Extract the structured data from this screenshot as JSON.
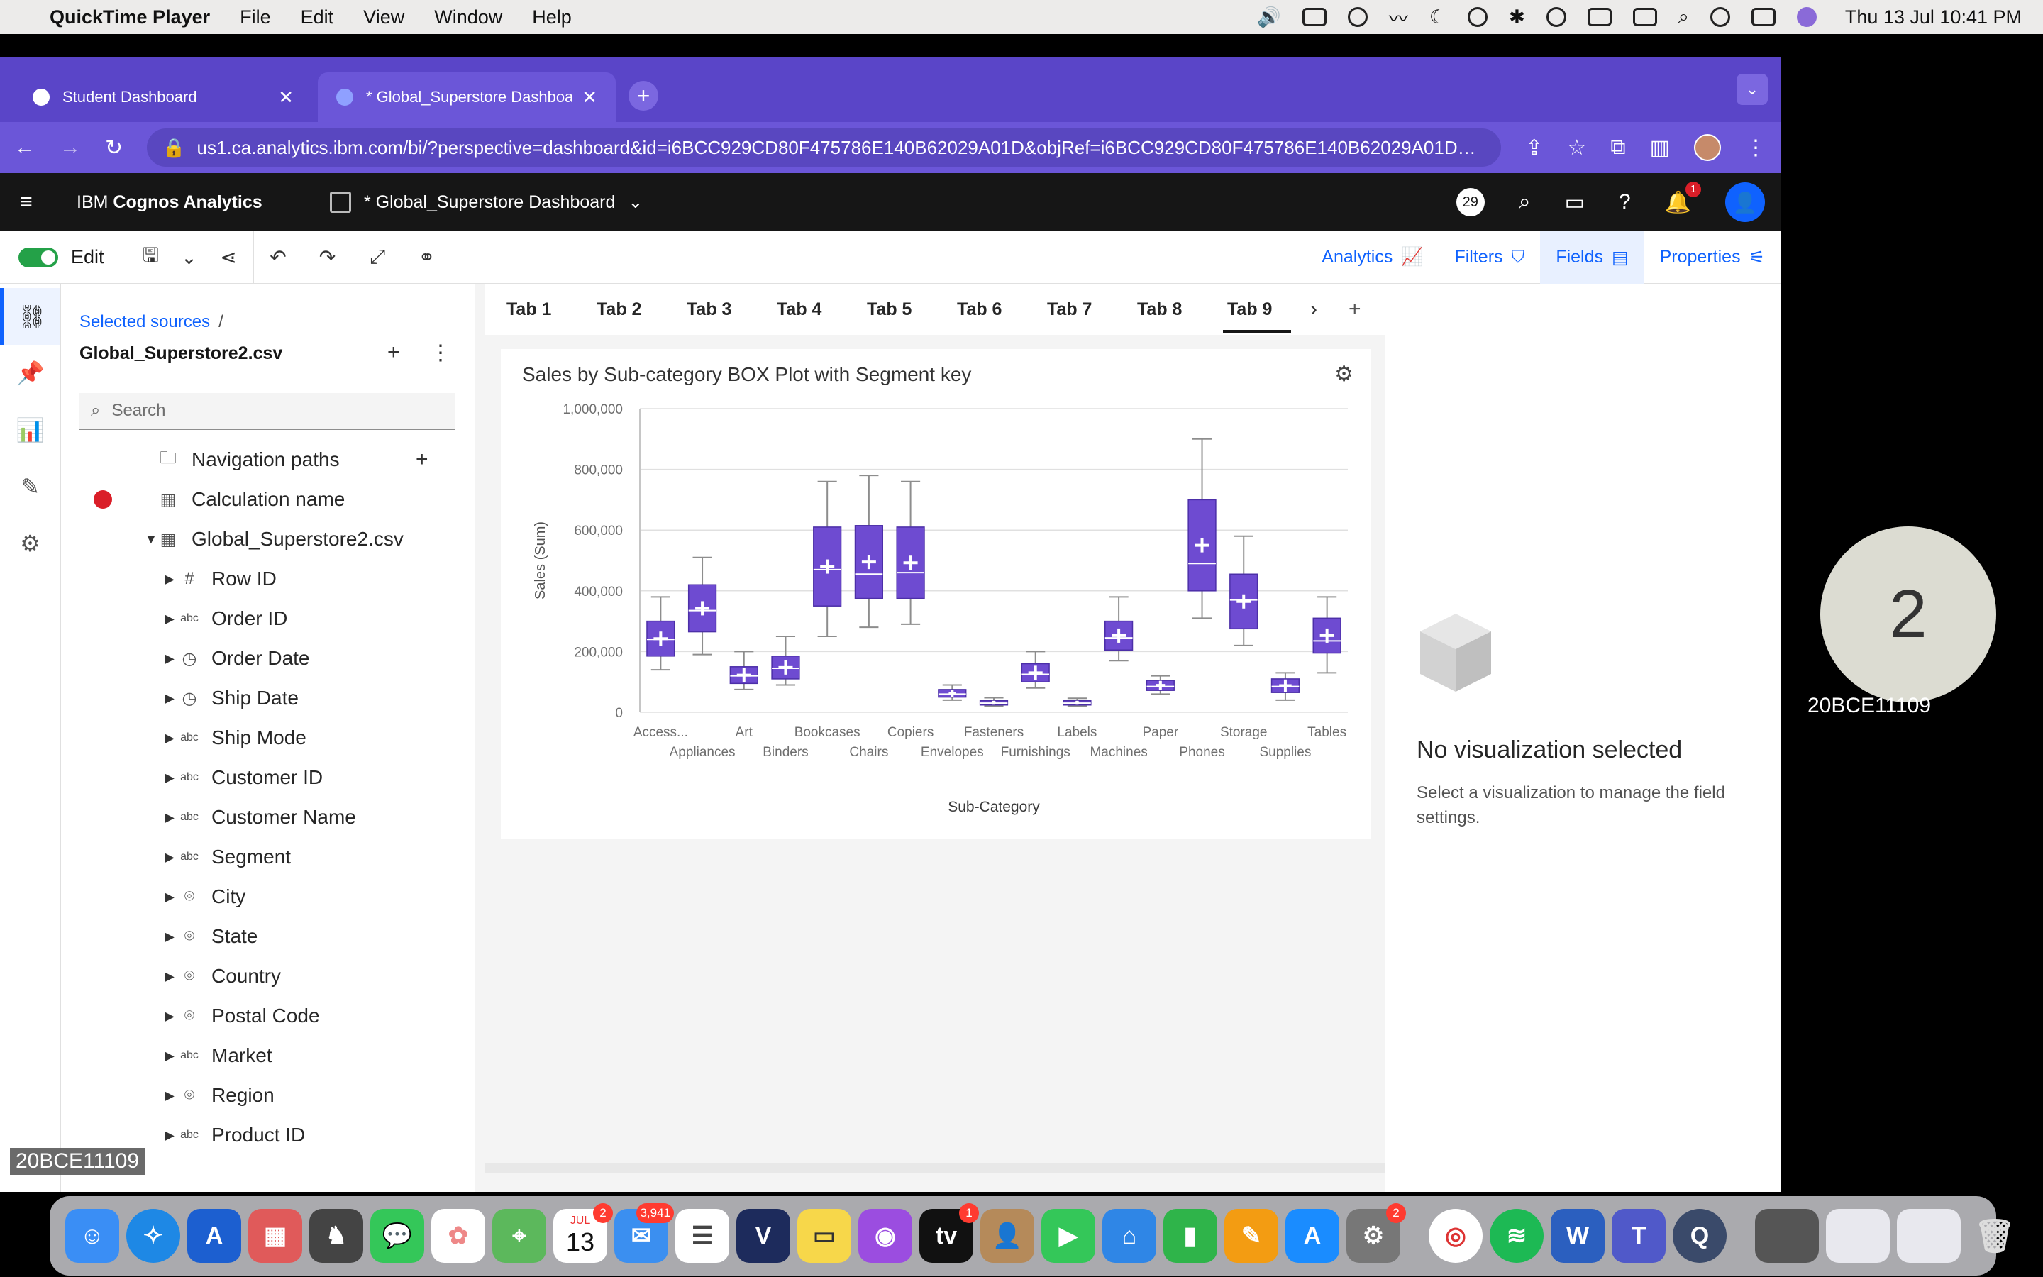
{
  "menubar": {
    "app": "QuickTime Player",
    "items": [
      "File",
      "Edit",
      "View",
      "Window",
      "Help"
    ],
    "clock": "Thu 13 Jul  10:41 PM"
  },
  "browser": {
    "tabs": [
      {
        "title": "Student Dashboard"
      },
      {
        "title": "* Global_Superstore Dashboa"
      }
    ],
    "url": "us1.ca.analytics.ibm.com/bi/?perspective=dashboard&id=i6BCC929CD80F475786E140B62029A01D&objRef=i6BCC929CD80F475786E140B62029A01D&opti..."
  },
  "cognos": {
    "brand_prefix": "IBM",
    "brand_name": "Cognos Analytics",
    "dashboard_title": "* Global_Superstore Dashboard",
    "badge_count": "29",
    "notifications": "1"
  },
  "toolbar": {
    "edit_label": "Edit",
    "analytics": "Analytics",
    "filters": "Filters",
    "fields": "Fields",
    "properties": "Properties"
  },
  "sources": {
    "breadcrumb": "Selected sources",
    "breadcrumb_sep": "/",
    "name": "Global_Superstore2.csv",
    "search_placeholder": "Search",
    "tree": [
      {
        "label": "Navigation paths",
        "icon": "folder-icon",
        "level": 0,
        "caret": false,
        "plus": true
      },
      {
        "label": "Calculation name",
        "icon": "calc-icon",
        "level": 0,
        "caret": false,
        "error": true
      },
      {
        "label": "Global_Superstore2.csv",
        "icon": "table-icon",
        "level": 0,
        "caret": "open"
      },
      {
        "label": "Row ID",
        "icon": "hash-icon",
        "level": 1,
        "caret": "closed"
      },
      {
        "label": "Order ID",
        "icon": "abc-icon",
        "level": 1,
        "caret": "closed"
      },
      {
        "label": "Order Date",
        "icon": "clock-icon",
        "level": 1,
        "caret": "closed"
      },
      {
        "label": "Ship Date",
        "icon": "clock-icon",
        "level": 1,
        "caret": "closed"
      },
      {
        "label": "Ship Mode",
        "icon": "abc-icon",
        "level": 1,
        "caret": "closed"
      },
      {
        "label": "Customer ID",
        "icon": "abc-icon",
        "level": 1,
        "caret": "closed"
      },
      {
        "label": "Customer Name",
        "icon": "abc-icon",
        "level": 1,
        "caret": "closed"
      },
      {
        "label": "Segment",
        "icon": "abc-icon",
        "level": 1,
        "caret": "closed"
      },
      {
        "label": "City",
        "icon": "location-icon",
        "level": 1,
        "caret": "closed"
      },
      {
        "label": "State",
        "icon": "location-icon",
        "level": 1,
        "caret": "closed"
      },
      {
        "label": "Country",
        "icon": "location-icon",
        "level": 1,
        "caret": "closed"
      },
      {
        "label": "Postal Code",
        "icon": "location-icon",
        "level": 1,
        "caret": "closed"
      },
      {
        "label": "Market",
        "icon": "abc-icon",
        "level": 1,
        "caret": "closed"
      },
      {
        "label": "Region",
        "icon": "location-icon",
        "level": 1,
        "caret": "closed"
      },
      {
        "label": "Product ID",
        "icon": "abc-icon",
        "level": 1,
        "caret": "closed"
      }
    ]
  },
  "canvas": {
    "tabs": [
      "Tab 1",
      "Tab 2",
      "Tab 3",
      "Tab 4",
      "Tab 5",
      "Tab 6",
      "Tab 7",
      "Tab 8",
      "Tab 9"
    ],
    "active_tab": "Tab 9",
    "viz_title": "Sales by Sub-category BOX Plot with Segment key"
  },
  "chart_data": {
    "type": "box",
    "title": "Sales by Sub-category BOX Plot with Segment key",
    "xlabel": "Sub-Category",
    "ylabel": "Sales (Sum)",
    "ylim": [
      0,
      1000000
    ],
    "yticks": [
      "0",
      "200,000",
      "400,000",
      "600,000",
      "800,000",
      "1,000,000"
    ],
    "ytick_values": [
      0,
      200000,
      400000,
      600000,
      800000,
      1000000
    ],
    "color": "#6e4bd1",
    "categories": [
      "Access...",
      "Appliances",
      "Art",
      "Binders",
      "Bookcases",
      "Chairs",
      "Copiers",
      "Envelopes",
      "Fasteners",
      "Furnishings",
      "Labels",
      "Machines",
      "Paper",
      "Phones",
      "Storage",
      "Supplies",
      "Tables"
    ],
    "boxes": [
      {
        "min": 140000,
        "q1": 185000,
        "median": 240000,
        "q3": 300000,
        "max": 380000
      },
      {
        "min": 190000,
        "q1": 265000,
        "median": 335000,
        "q3": 420000,
        "max": 510000
      },
      {
        "min": 75000,
        "q1": 95000,
        "median": 120000,
        "q3": 150000,
        "max": 200000
      },
      {
        "min": 90000,
        "q1": 110000,
        "median": 145000,
        "q3": 185000,
        "max": 250000
      },
      {
        "min": 250000,
        "q1": 350000,
        "median": 470000,
        "q3": 610000,
        "max": 760000
      },
      {
        "min": 280000,
        "q1": 375000,
        "median": 455000,
        "q3": 615000,
        "max": 780000
      },
      {
        "min": 290000,
        "q1": 375000,
        "median": 460000,
        "q3": 610000,
        "max": 760000
      },
      {
        "min": 40000,
        "q1": 50000,
        "median": 60000,
        "q3": 75000,
        "max": 90000
      },
      {
        "min": 20000,
        "q1": 25000,
        "median": 30000,
        "q3": 38000,
        "max": 48000
      },
      {
        "min": 80000,
        "q1": 100000,
        "median": 125000,
        "q3": 160000,
        "max": 200000
      },
      {
        "min": 20000,
        "q1": 25000,
        "median": 30000,
        "q3": 38000,
        "max": 46000
      },
      {
        "min": 170000,
        "q1": 205000,
        "median": 245000,
        "q3": 300000,
        "max": 380000
      },
      {
        "min": 60000,
        "q1": 72000,
        "median": 85000,
        "q3": 105000,
        "max": 120000
      },
      {
        "min": 310000,
        "q1": 400000,
        "median": 490000,
        "q3": 700000,
        "max": 900000
      },
      {
        "min": 220000,
        "q1": 275000,
        "median": 370000,
        "q3": 455000,
        "max": 580000
      },
      {
        "min": 40000,
        "q1": 65000,
        "median": 85000,
        "q3": 110000,
        "max": 130000
      },
      {
        "min": 130000,
        "q1": 195000,
        "median": 235000,
        "q3": 310000,
        "max": 380000
      }
    ]
  },
  "properties": {
    "heading": "No visualization selected",
    "text": "Select a visualization to manage the field settings."
  },
  "participant": {
    "number": "2",
    "name": "20BCE11109"
  },
  "watermark": "20BCE11109",
  "dock": {
    "calendar_month": "JUL",
    "calendar_day": "13",
    "badges": {
      "calendar": "2",
      "mail": "3,941",
      "tv": "1",
      "settings": "2"
    }
  }
}
